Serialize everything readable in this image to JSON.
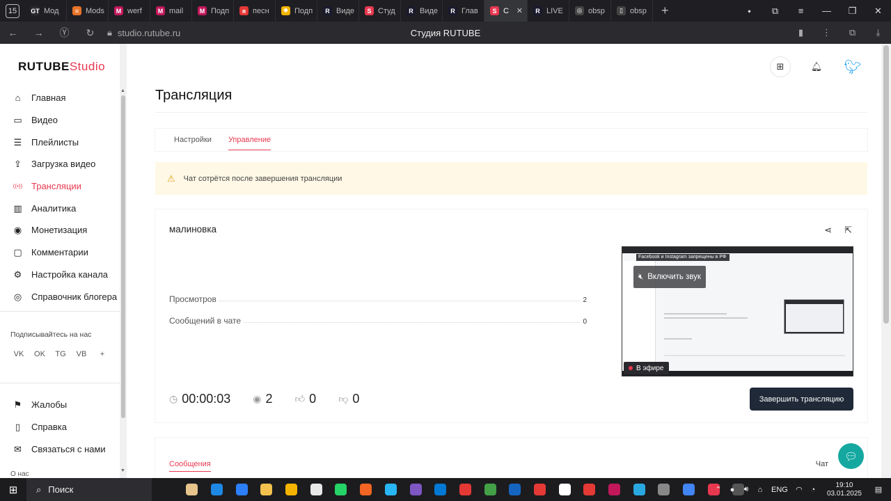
{
  "browser": {
    "tab_count": "15",
    "tabs": [
      {
        "label": "Мод",
        "fav": "GT",
        "color": "#2b2b2f",
        "active": false
      },
      {
        "label": "Mods",
        "fav": "≡",
        "color": "#e8742a",
        "active": false
      },
      {
        "label": "werf",
        "fav": "M",
        "color": "#c2185b",
        "active": false
      },
      {
        "label": "mail",
        "fav": "M",
        "color": "#c2185b",
        "active": false
      },
      {
        "label": "Подп",
        "fav": "M",
        "color": "#c2185b",
        "active": false
      },
      {
        "label": "песн",
        "fav": "я",
        "color": "#e53935",
        "active": false
      },
      {
        "label": "Подп",
        "fav": "✺",
        "color": "#f4b400",
        "active": false
      },
      {
        "label": "Виде",
        "fav": "R",
        "color": "#1a1a2e",
        "active": false
      },
      {
        "label": "Студ",
        "fav": "S",
        "color": "#e8384f",
        "active": false
      },
      {
        "label": "Виде",
        "fav": "R",
        "color": "#1a1a2e",
        "active": false
      },
      {
        "label": "Глав",
        "fav": "R",
        "color": "#1a1a2e",
        "active": false
      },
      {
        "label": "С",
        "fav": "S",
        "color": "#e8384f",
        "active": true
      },
      {
        "label": "LIVE",
        "fav": "R",
        "color": "#1a1a2e",
        "active": false
      },
      {
        "label": "obsp",
        "fav": "◎",
        "color": "#444",
        "active": false
      },
      {
        "label": "obsp",
        "fav": "▯",
        "color": "#444",
        "active": false
      }
    ],
    "url": "studio.rutube.ru",
    "page_title": "Студия RUTUBE"
  },
  "logo": {
    "main": "RUTUBE",
    "accent": "Studio"
  },
  "sidebar": {
    "items": [
      {
        "label": "Главная",
        "icon": "⌂",
        "active": false
      },
      {
        "label": "Видео",
        "icon": "▭",
        "active": false
      },
      {
        "label": "Плейлисты",
        "icon": "☰",
        "active": false
      },
      {
        "label": "Загрузка видео",
        "icon": "⇪",
        "active": false
      },
      {
        "label": "Трансляции",
        "icon": "((•))",
        "active": true
      },
      {
        "label": "Аналитика",
        "icon": "▥",
        "active": false
      },
      {
        "label": "Монетизация",
        "icon": "◉",
        "active": false
      },
      {
        "label": "Комментарии",
        "icon": "▢",
        "active": false
      },
      {
        "label": "Настройка канала",
        "icon": "⚙",
        "active": false
      },
      {
        "label": "Справочник блогера",
        "icon": "◎",
        "active": false
      }
    ],
    "follow_title": "Подписывайтесь на нас",
    "socials": [
      "VK",
      "OK",
      "TG",
      "VB",
      "+"
    ],
    "secondary": [
      {
        "label": "Жалобы",
        "icon": "⚑"
      },
      {
        "label": "Справка",
        "icon": "▯"
      },
      {
        "label": "Связаться с нами",
        "icon": "✉"
      }
    ],
    "more": "О нас"
  },
  "main": {
    "title": "Трансляция",
    "tabs": [
      {
        "label": "Настройки",
        "active": false
      },
      {
        "label": "Управление",
        "active": true
      }
    ],
    "notice": "Чат сотрётся после завершения трансляции",
    "stream": {
      "name": "малиновка",
      "stats": [
        {
          "label": "Просмотров",
          "value": "2"
        },
        {
          "label": "Сообщений в чате",
          "value": "0"
        }
      ],
      "duration": "00:00:03",
      "viewers": "2",
      "likes": "0",
      "dislikes": "0",
      "preview_banner": "Facebook и Instagram запрещены в РФ",
      "unmute_label": "Включить звук",
      "on_air_label": "В эфире",
      "end_button": "Завершить трансляцию"
    },
    "messages_tab": "Сообщения",
    "chat_label": "Чат"
  },
  "taskbar": {
    "search_placeholder": "Поиск",
    "apps": [
      "#e6c48b",
      "#1e88e5",
      "#2d7ff9",
      "#f2c14e",
      "#f4b400",
      "#e8e8e8",
      "#25d366",
      "#f26522",
      "#29b6f6",
      "#7e57c2",
      "#0078d4",
      "#e53935",
      "#43a047",
      "#1565c0",
      "#e53935",
      "#ffffff",
      "#e53935",
      "#c2185b",
      "#29a8e0",
      "#888888",
      "#4285f4",
      "#e8384f",
      "#555555"
    ],
    "lang": "ENG",
    "time": "19:10",
    "date": "03.01.2025"
  },
  "colors": {
    "accent": "#e8384f",
    "notice_bg": "#fff8e6",
    "button_dark": "#1f2937",
    "fab": "#14a8a0"
  }
}
